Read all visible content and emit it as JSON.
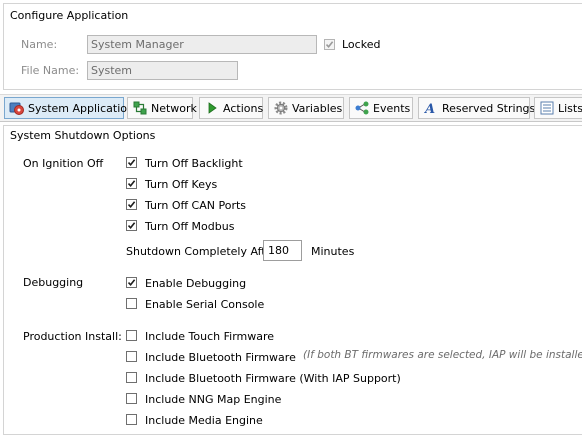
{
  "config": {
    "title": "Configure Application",
    "name_label": "Name:",
    "name_value": "System Manager",
    "locked_label": "Locked",
    "locked_checked": true,
    "file_name_label": "File Name:",
    "file_name_value": "System"
  },
  "tabs": [
    {
      "label": "System Application",
      "icon": "system-app-icon",
      "active": true
    },
    {
      "label": "Network",
      "icon": "network-icon",
      "active": false
    },
    {
      "label": "Actions",
      "icon": "play-icon",
      "active": false
    },
    {
      "label": "Variables",
      "icon": "gear-icon",
      "active": false
    },
    {
      "label": "Events",
      "icon": "events-icon",
      "active": false
    },
    {
      "label": "Reserved Strings",
      "icon": "font-icon",
      "active": false
    },
    {
      "label": "Lists",
      "icon": "list-icon",
      "active": false
    }
  ],
  "shutdown": {
    "title": "System Shutdown Options",
    "ignition_label": "On Ignition Off",
    "options": [
      {
        "label": "Turn Off Backlight",
        "checked": true
      },
      {
        "label": "Turn Off Keys",
        "checked": true
      },
      {
        "label": "Turn Off CAN Ports",
        "checked": true
      },
      {
        "label": "Turn Off Modbus",
        "checked": true
      }
    ],
    "shutdown_after_label": "Shutdown Completely After",
    "shutdown_after_value": "180",
    "minutes_label": "Minutes"
  },
  "debugging": {
    "label": "Debugging",
    "options": [
      {
        "label": "Enable Debugging",
        "checked": true
      },
      {
        "label": "Enable Serial Console",
        "checked": false
      }
    ]
  },
  "production": {
    "label": "Production Install:",
    "options": [
      {
        "label": "Include Touch Firmware",
        "checked": false
      },
      {
        "label": "Include Bluetooth Firmware",
        "checked": false
      },
      {
        "label": "Include Bluetooth Firmware (With IAP Support)",
        "checked": false
      },
      {
        "label": "Include NNG Map Engine",
        "checked": false
      },
      {
        "label": "Include Media Engine",
        "checked": false
      }
    ],
    "note": "(If both BT firmwares are selected, IAP will  be installed)"
  }
}
